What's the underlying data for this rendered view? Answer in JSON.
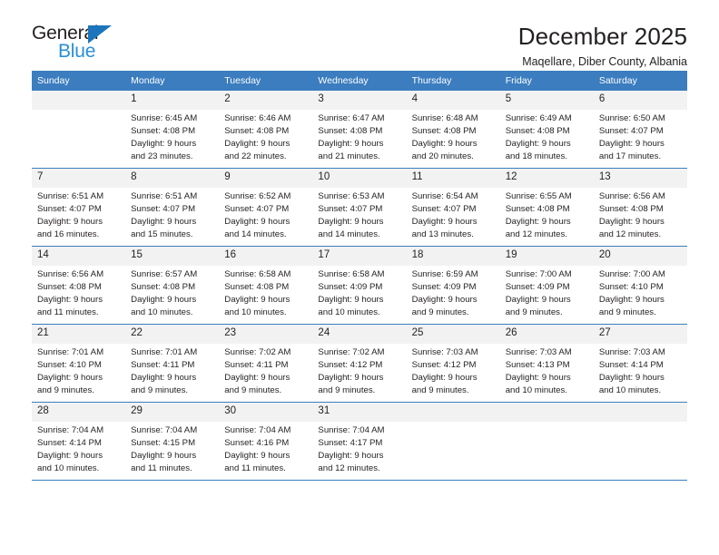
{
  "brand": {
    "line1": "General",
    "line2": "Blue",
    "triangle_icon": "triangle-icon",
    "colors": {
      "dark": "#231f20",
      "blue": "#2a8fd4",
      "triangle": "#1c75bc"
    }
  },
  "header": {
    "title": "December 2025",
    "subtitle": "Maqellare, Diber County, Albania"
  },
  "theme": {
    "header_row_bg": "#3b7dbf",
    "header_row_text": "#ffffff",
    "daynum_bg": "#f2f2f2",
    "grid_line": "#3b7dbf",
    "body_text": "#231f20"
  },
  "calendar": {
    "weekday_headers": [
      "Sunday",
      "Monday",
      "Tuesday",
      "Wednesday",
      "Thursday",
      "Friday",
      "Saturday"
    ],
    "weeks": [
      [
        {
          "day": "",
          "sunrise": "",
          "sunset": "",
          "daylight_line1": "",
          "daylight_line2": ""
        },
        {
          "day": "1",
          "sunrise": "Sunrise: 6:45 AM",
          "sunset": "Sunset: 4:08 PM",
          "daylight_line1": "Daylight: 9 hours",
          "daylight_line2": "and 23 minutes."
        },
        {
          "day": "2",
          "sunrise": "Sunrise: 6:46 AM",
          "sunset": "Sunset: 4:08 PM",
          "daylight_line1": "Daylight: 9 hours",
          "daylight_line2": "and 22 minutes."
        },
        {
          "day": "3",
          "sunrise": "Sunrise: 6:47 AM",
          "sunset": "Sunset: 4:08 PM",
          "daylight_line1": "Daylight: 9 hours",
          "daylight_line2": "and 21 minutes."
        },
        {
          "day": "4",
          "sunrise": "Sunrise: 6:48 AM",
          "sunset": "Sunset: 4:08 PM",
          "daylight_line1": "Daylight: 9 hours",
          "daylight_line2": "and 20 minutes."
        },
        {
          "day": "5",
          "sunrise": "Sunrise: 6:49 AM",
          "sunset": "Sunset: 4:08 PM",
          "daylight_line1": "Daylight: 9 hours",
          "daylight_line2": "and 18 minutes."
        },
        {
          "day": "6",
          "sunrise": "Sunrise: 6:50 AM",
          "sunset": "Sunset: 4:07 PM",
          "daylight_line1": "Daylight: 9 hours",
          "daylight_line2": "and 17 minutes."
        }
      ],
      [
        {
          "day": "7",
          "sunrise": "Sunrise: 6:51 AM",
          "sunset": "Sunset: 4:07 PM",
          "daylight_line1": "Daylight: 9 hours",
          "daylight_line2": "and 16 minutes."
        },
        {
          "day": "8",
          "sunrise": "Sunrise: 6:51 AM",
          "sunset": "Sunset: 4:07 PM",
          "daylight_line1": "Daylight: 9 hours",
          "daylight_line2": "and 15 minutes."
        },
        {
          "day": "9",
          "sunrise": "Sunrise: 6:52 AM",
          "sunset": "Sunset: 4:07 PM",
          "daylight_line1": "Daylight: 9 hours",
          "daylight_line2": "and 14 minutes."
        },
        {
          "day": "10",
          "sunrise": "Sunrise: 6:53 AM",
          "sunset": "Sunset: 4:07 PM",
          "daylight_line1": "Daylight: 9 hours",
          "daylight_line2": "and 14 minutes."
        },
        {
          "day": "11",
          "sunrise": "Sunrise: 6:54 AM",
          "sunset": "Sunset: 4:07 PM",
          "daylight_line1": "Daylight: 9 hours",
          "daylight_line2": "and 13 minutes."
        },
        {
          "day": "12",
          "sunrise": "Sunrise: 6:55 AM",
          "sunset": "Sunset: 4:08 PM",
          "daylight_line1": "Daylight: 9 hours",
          "daylight_line2": "and 12 minutes."
        },
        {
          "day": "13",
          "sunrise": "Sunrise: 6:56 AM",
          "sunset": "Sunset: 4:08 PM",
          "daylight_line1": "Daylight: 9 hours",
          "daylight_line2": "and 12 minutes."
        }
      ],
      [
        {
          "day": "14",
          "sunrise": "Sunrise: 6:56 AM",
          "sunset": "Sunset: 4:08 PM",
          "daylight_line1": "Daylight: 9 hours",
          "daylight_line2": "and 11 minutes."
        },
        {
          "day": "15",
          "sunrise": "Sunrise: 6:57 AM",
          "sunset": "Sunset: 4:08 PM",
          "daylight_line1": "Daylight: 9 hours",
          "daylight_line2": "and 10 minutes."
        },
        {
          "day": "16",
          "sunrise": "Sunrise: 6:58 AM",
          "sunset": "Sunset: 4:08 PM",
          "daylight_line1": "Daylight: 9 hours",
          "daylight_line2": "and 10 minutes."
        },
        {
          "day": "17",
          "sunrise": "Sunrise: 6:58 AM",
          "sunset": "Sunset: 4:09 PM",
          "daylight_line1": "Daylight: 9 hours",
          "daylight_line2": "and 10 minutes."
        },
        {
          "day": "18",
          "sunrise": "Sunrise: 6:59 AM",
          "sunset": "Sunset: 4:09 PM",
          "daylight_line1": "Daylight: 9 hours",
          "daylight_line2": "and 9 minutes."
        },
        {
          "day": "19",
          "sunrise": "Sunrise: 7:00 AM",
          "sunset": "Sunset: 4:09 PM",
          "daylight_line1": "Daylight: 9 hours",
          "daylight_line2": "and 9 minutes."
        },
        {
          "day": "20",
          "sunrise": "Sunrise: 7:00 AM",
          "sunset": "Sunset: 4:10 PM",
          "daylight_line1": "Daylight: 9 hours",
          "daylight_line2": "and 9 minutes."
        }
      ],
      [
        {
          "day": "21",
          "sunrise": "Sunrise: 7:01 AM",
          "sunset": "Sunset: 4:10 PM",
          "daylight_line1": "Daylight: 9 hours",
          "daylight_line2": "and 9 minutes."
        },
        {
          "day": "22",
          "sunrise": "Sunrise: 7:01 AM",
          "sunset": "Sunset: 4:11 PM",
          "daylight_line1": "Daylight: 9 hours",
          "daylight_line2": "and 9 minutes."
        },
        {
          "day": "23",
          "sunrise": "Sunrise: 7:02 AM",
          "sunset": "Sunset: 4:11 PM",
          "daylight_line1": "Daylight: 9 hours",
          "daylight_line2": "and 9 minutes."
        },
        {
          "day": "24",
          "sunrise": "Sunrise: 7:02 AM",
          "sunset": "Sunset: 4:12 PM",
          "daylight_line1": "Daylight: 9 hours",
          "daylight_line2": "and 9 minutes."
        },
        {
          "day": "25",
          "sunrise": "Sunrise: 7:03 AM",
          "sunset": "Sunset: 4:12 PM",
          "daylight_line1": "Daylight: 9 hours",
          "daylight_line2": "and 9 minutes."
        },
        {
          "day": "26",
          "sunrise": "Sunrise: 7:03 AM",
          "sunset": "Sunset: 4:13 PM",
          "daylight_line1": "Daylight: 9 hours",
          "daylight_line2": "and 10 minutes."
        },
        {
          "day": "27",
          "sunrise": "Sunrise: 7:03 AM",
          "sunset": "Sunset: 4:14 PM",
          "daylight_line1": "Daylight: 9 hours",
          "daylight_line2": "and 10 minutes."
        }
      ],
      [
        {
          "day": "28",
          "sunrise": "Sunrise: 7:04 AM",
          "sunset": "Sunset: 4:14 PM",
          "daylight_line1": "Daylight: 9 hours",
          "daylight_line2": "and 10 minutes."
        },
        {
          "day": "29",
          "sunrise": "Sunrise: 7:04 AM",
          "sunset": "Sunset: 4:15 PM",
          "daylight_line1": "Daylight: 9 hours",
          "daylight_line2": "and 11 minutes."
        },
        {
          "day": "30",
          "sunrise": "Sunrise: 7:04 AM",
          "sunset": "Sunset: 4:16 PM",
          "daylight_line1": "Daylight: 9 hours",
          "daylight_line2": "and 11 minutes."
        },
        {
          "day": "31",
          "sunrise": "Sunrise: 7:04 AM",
          "sunset": "Sunset: 4:17 PM",
          "daylight_line1": "Daylight: 9 hours",
          "daylight_line2": "and 12 minutes."
        },
        {
          "day": "",
          "sunrise": "",
          "sunset": "",
          "daylight_line1": "",
          "daylight_line2": ""
        },
        {
          "day": "",
          "sunrise": "",
          "sunset": "",
          "daylight_line1": "",
          "daylight_line2": ""
        },
        {
          "day": "",
          "sunrise": "",
          "sunset": "",
          "daylight_line1": "",
          "daylight_line2": ""
        }
      ]
    ]
  }
}
